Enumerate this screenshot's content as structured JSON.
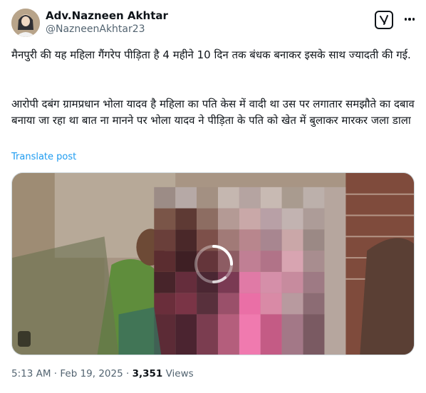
{
  "tweet": {
    "author_name": "Adv.Nazneen Akhtar",
    "author_handle": "@NazneenAkhtar23",
    "paragraph_1": "मैनपुरी की यह महिला गैंगरेप पीड़िता है 4 महीने 10 दिन तक बंधक बनाकर इसके साथ ज्यादती की गई.",
    "paragraph_2": "आरोपी दबंग ग्रामप्रधान भोला यादव है महिला का पति केस में वादी था उस पर लगातार समझौते का दबाव बनाया जा रहा था बात ना मानने पर भोला यादव ने पीड़िता के पति को खेत में बुलाकर मारकर जला डाला",
    "translate_label": "Translate post",
    "time": "5:13 AM",
    "separator": "·",
    "date": "Feb 19, 2025",
    "views_count": "3,351",
    "views_label": "Views"
  },
  "icons": {
    "grok": "grok-icon",
    "more": "more-options-icon",
    "spinner": "loading-spinner-icon"
  },
  "colors": {
    "text": "#0f1419",
    "secondary": "#536471",
    "link": "#1d9bf0"
  }
}
